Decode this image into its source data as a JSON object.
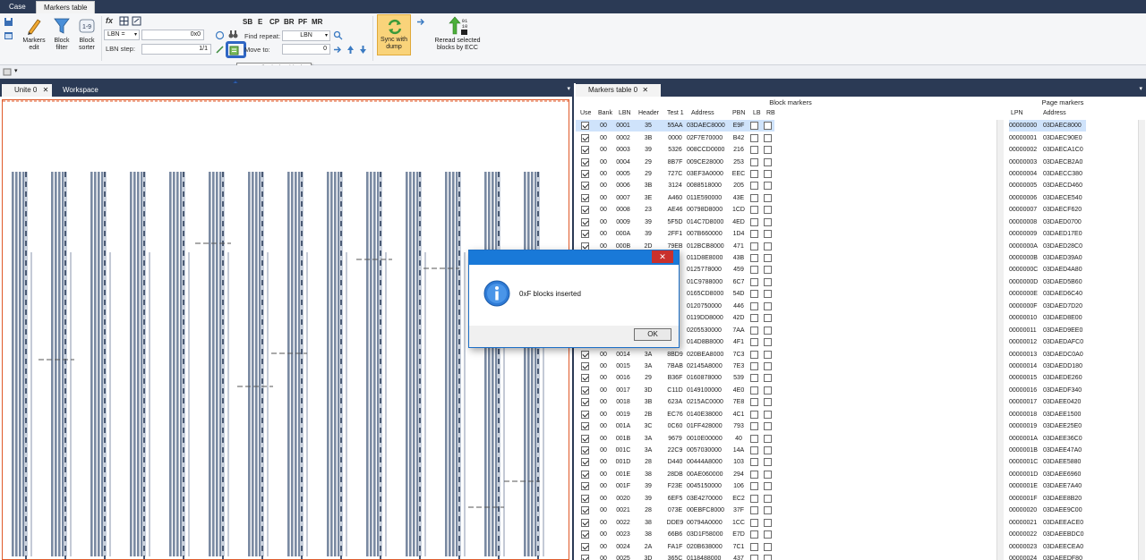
{
  "tabs": [
    "Case",
    "Markers table"
  ],
  "ribbon": {
    "markers_edit": "Markers\nedit",
    "block_filter": "Block\nfilter",
    "block_sorter": "Block\nsorter",
    "fx_label": "fx",
    "lbn_combo": "LBN =",
    "lbn_value": "0x0",
    "lbn_step_label": "LBN step:",
    "lbn_step_value": "1/1",
    "tags": [
      "SB",
      "E",
      "CP",
      "BR",
      "PF",
      "MR"
    ],
    "find_repeat_label": "Find repeat:",
    "find_repeat_value": "LBN",
    "move_to_label": "Move to:",
    "move_to_value": "0",
    "sync_label": "Sync with dump",
    "reread_label": "Reread selected blocks by ECC",
    "tooltip": "Insert all missing blocks"
  },
  "doc_tabs": [
    "Unite 0",
    "Workspace"
  ],
  "right": {
    "tab": "Markers table 0",
    "block_markers": "Block markers",
    "page_markers": "Page markers",
    "cols": [
      "Use",
      "Bank",
      "LBN",
      "Header",
      "Test 1",
      "Address",
      "PBN",
      "LB",
      "RB"
    ],
    "page_cols": [
      "LPN",
      "Address"
    ],
    "rows": [
      [
        "00",
        "0001",
        "35",
        "55AA",
        "03DAEC8000",
        "E9F"
      ],
      [
        "00",
        "0002",
        "3B",
        "0000",
        "02F7E70000",
        "B42"
      ],
      [
        "00",
        "0003",
        "39",
        "5326",
        "008CCD0000",
        "216"
      ],
      [
        "00",
        "0004",
        "29",
        "8B7F",
        "009CE28000",
        "253"
      ],
      [
        "00",
        "0005",
        "29",
        "727C",
        "03EF3A0000",
        "EEC"
      ],
      [
        "00",
        "0006",
        "3B",
        "3124",
        "0088518000",
        "205"
      ],
      [
        "00",
        "0007",
        "3E",
        "A460",
        "011E590000",
        "43E"
      ],
      [
        "00",
        "0008",
        "23",
        "AE46",
        "00798D8000",
        "1CD"
      ],
      [
        "00",
        "0009",
        "39",
        "5F5D",
        "014C7D8000",
        "4ED"
      ],
      [
        "00",
        "000A",
        "39",
        "2FF1",
        "007B660000",
        "1D4"
      ],
      [
        "00",
        "000B",
        "2D",
        "79EB",
        "012BCB8000",
        "471"
      ],
      [
        "00",
        "000C",
        "",
        "",
        "011D8E8000",
        "43B"
      ],
      [
        "00",
        "000D",
        "",
        "5",
        "0125778000",
        "459"
      ],
      [
        "00",
        "000E",
        "",
        "3",
        "01C9788000",
        "6C7"
      ],
      [
        "00",
        "000F",
        "",
        "9",
        "0165CD8000",
        "54D"
      ],
      [
        "00",
        "0010",
        "",
        "",
        "0120750000",
        "446"
      ],
      [
        "00",
        "0011",
        "",
        "5",
        "0119DD8000",
        "42D"
      ],
      [
        "00",
        "0012",
        "",
        "5",
        "0205530000",
        "7AA"
      ],
      [
        "00",
        "0013",
        "",
        "4",
        "014D8B8000",
        "4F1"
      ],
      [
        "00",
        "0014",
        "3A",
        "8BD9",
        "020BEA8000",
        "7C3"
      ],
      [
        "00",
        "0015",
        "3A",
        "7BAB",
        "02145A8000",
        "7E3"
      ],
      [
        "00",
        "0016",
        "29",
        "B36F",
        "0160878000",
        "539"
      ],
      [
        "00",
        "0017",
        "3D",
        "C11D",
        "0149100000",
        "4E0"
      ],
      [
        "00",
        "0018",
        "3B",
        "623A",
        "0215AC0000",
        "7E8"
      ],
      [
        "00",
        "0019",
        "2B",
        "EC76",
        "0140E38000",
        "4C1"
      ],
      [
        "00",
        "001A",
        "3C",
        "0C60",
        "01FF428000",
        "793"
      ],
      [
        "00",
        "001B",
        "3A",
        "9679",
        "0010E00000",
        "40"
      ],
      [
        "00",
        "001C",
        "3A",
        "22C9",
        "0057030000",
        "14A"
      ],
      [
        "00",
        "001D",
        "28",
        "D440",
        "00444A8000",
        "103"
      ],
      [
        "00",
        "001E",
        "38",
        "28DB",
        "00AE060000",
        "294"
      ],
      [
        "00",
        "001F",
        "39",
        "F23E",
        "0045150000",
        "106"
      ],
      [
        "00",
        "0020",
        "39",
        "6EF5",
        "03E4270000",
        "EC2"
      ],
      [
        "00",
        "0021",
        "28",
        "073E",
        "00EBFC8000",
        "37F"
      ],
      [
        "00",
        "0022",
        "38",
        "DDE9",
        "00794A0000",
        "1CC"
      ],
      [
        "00",
        "0023",
        "38",
        "66B6",
        "03D1F58000",
        "E7D"
      ],
      [
        "00",
        "0024",
        "2A",
        "FA1F",
        "020B638000",
        "7C1"
      ],
      [
        "00",
        "0025",
        "3D",
        "365C",
        "0118488000",
        "437"
      ]
    ],
    "pages": [
      [
        "00000000",
        "03DAEC8000"
      ],
      [
        "00000001",
        "03DAEC90E0"
      ],
      [
        "00000002",
        "03DAECA1C0"
      ],
      [
        "00000003",
        "03DAECB2A0"
      ],
      [
        "00000004",
        "03DAECC380"
      ],
      [
        "00000005",
        "03DAECD460"
      ],
      [
        "00000006",
        "03DAECE540"
      ],
      [
        "00000007",
        "03DAECF620"
      ],
      [
        "00000008",
        "03DAED0700"
      ],
      [
        "00000009",
        "03DAED17E0"
      ],
      [
        "0000000A",
        "03DAED28C0"
      ],
      [
        "0000000B",
        "03DAED39A0"
      ],
      [
        "0000000C",
        "03DAED4A80"
      ],
      [
        "0000000D",
        "03DAED5B60"
      ],
      [
        "0000000E",
        "03DAED6C40"
      ],
      [
        "0000000F",
        "03DAED7D20"
      ],
      [
        "00000010",
        "03DAED8E00"
      ],
      [
        "00000011",
        "03DAED9EE0"
      ],
      [
        "00000012",
        "03DAEDAFC0"
      ],
      [
        "00000013",
        "03DAEDC0A0"
      ],
      [
        "00000014",
        "03DAEDD180"
      ],
      [
        "00000015",
        "03DAEDE260"
      ],
      [
        "00000016",
        "03DAEDF340"
      ],
      [
        "00000017",
        "03DAEE0420"
      ],
      [
        "00000018",
        "03DAEE1500"
      ],
      [
        "00000019",
        "03DAEE25E0"
      ],
      [
        "0000001A",
        "03DAEE36C0"
      ],
      [
        "0000001B",
        "03DAEE47A0"
      ],
      [
        "0000001C",
        "03DAEE5880"
      ],
      [
        "0000001D",
        "03DAEE6960"
      ],
      [
        "0000001E",
        "03DAEE7A40"
      ],
      [
        "0000001F",
        "03DAEE8B20"
      ],
      [
        "00000020",
        "03DAEE9C00"
      ],
      [
        "00000021",
        "03DAEEACE0"
      ],
      [
        "00000022",
        "03DAEEBDC0"
      ],
      [
        "00000023",
        "03DAEECEA0"
      ],
      [
        "00000024",
        "03DAEEDF80"
      ]
    ]
  },
  "dialog": {
    "message": "0xF blocks inserted",
    "ok": "OK",
    "close": "✕"
  },
  "colors": {
    "accent": "#2b3a55",
    "dialog_title": "#1979d8",
    "highlight": "#2f66c4"
  }
}
